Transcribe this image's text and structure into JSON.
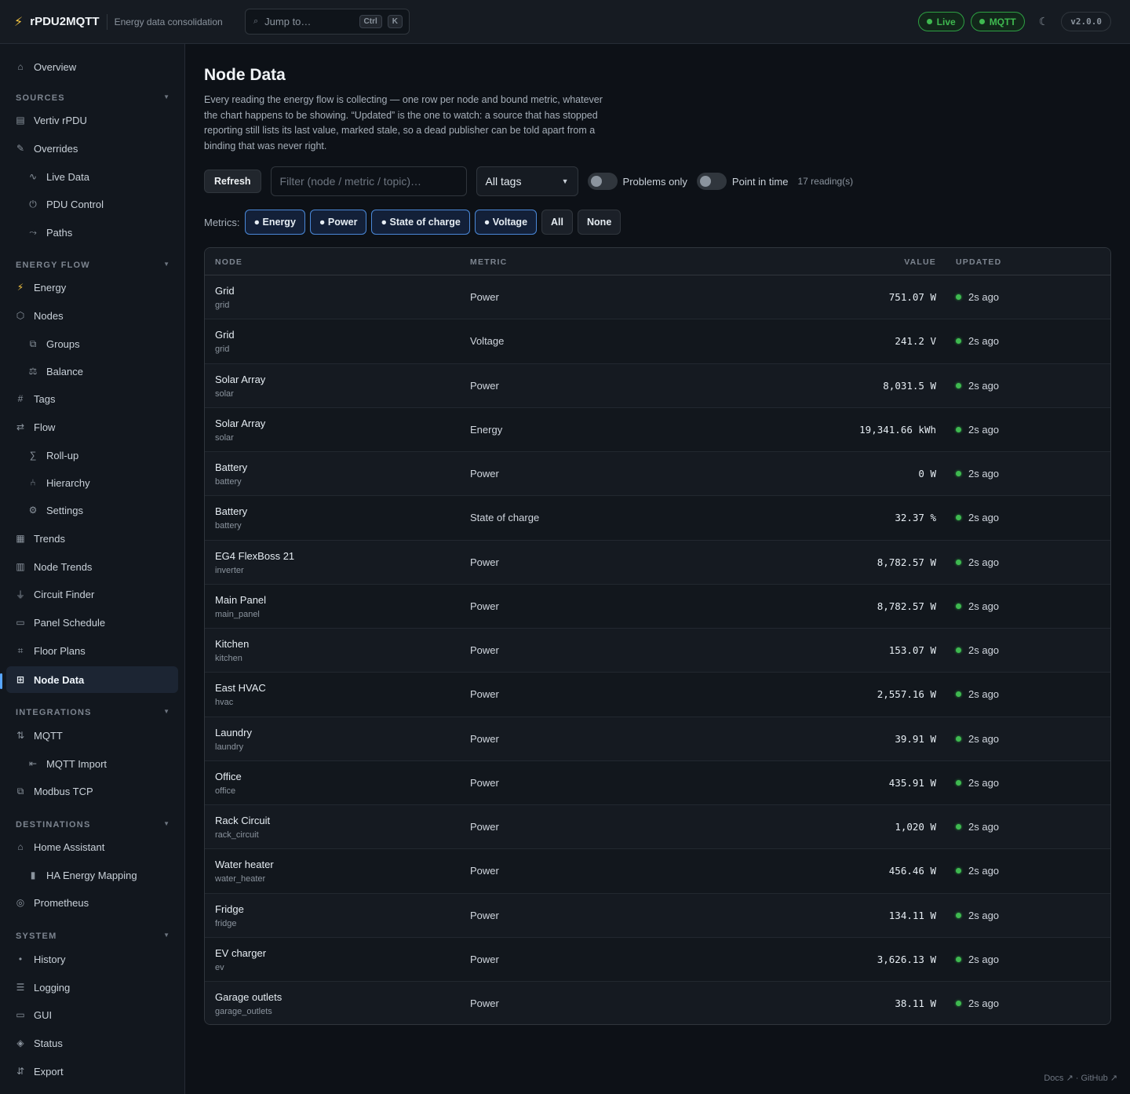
{
  "app": {
    "name": "rPDU2MQTT",
    "tagline": "Energy data consolidation",
    "jump_placeholder": "Jump to…",
    "kbd": [
      "Ctrl",
      "K"
    ],
    "badges": [
      "Live",
      "MQTT"
    ],
    "version": "v2.0.0"
  },
  "sidebar": {
    "overview": "Overview",
    "sections": {
      "sources": "SOURCES",
      "energy_flow": "ENERGY FLOW",
      "integrations": "INTEGRATIONS",
      "destinations": "DESTINATIONS",
      "system": "SYSTEM"
    },
    "items": {
      "vertiv": "Vertiv rPDU",
      "overrides": "Overrides",
      "live_data": "Live Data",
      "pdu_control": "PDU Control",
      "paths": "Paths",
      "energy": "Energy",
      "nodes": "Nodes",
      "groups": "Groups",
      "balance": "Balance",
      "tags": "Tags",
      "flow": "Flow",
      "rollup": "Roll-up",
      "hierarchy": "Hierarchy",
      "settings": "Settings",
      "trends": "Trends",
      "node_trends": "Node Trends",
      "circuit_finder": "Circuit Finder",
      "panel_schedule": "Panel Schedule",
      "floor_plans": "Floor Plans",
      "node_data": "Node Data",
      "mqtt": "MQTT",
      "mqtt_import": "MQTT Import",
      "modbus": "Modbus TCP",
      "home_assistant": "Home Assistant",
      "ha_energy": "HA Energy Mapping",
      "prometheus": "Prometheus",
      "history": "History",
      "logging": "Logging",
      "gui": "GUI",
      "status": "Status",
      "export": "Export"
    }
  },
  "page": {
    "title": "Node Data",
    "description": "Every reading the energy flow is collecting — one row per node and bound metric, whatever the chart happens to be showing. “Updated” is the one to watch: a source that has stopped reporting still lists its last value, marked stale, so a dead publisher can be told apart from a binding that was never right.",
    "refresh_label": "Refresh",
    "filter_placeholder": "Filter (node / metric / topic)…",
    "tags_select": "All tags",
    "problems_only": "Problems only",
    "point_in_time": "Point in time",
    "reading_count": "17 reading(s)",
    "metrics_label": "Metrics:",
    "metric_chips": [
      "● Energy",
      "● Power",
      "● State of charge",
      "● Voltage"
    ],
    "chip_all": "All",
    "chip_none": "None"
  },
  "table": {
    "headers": {
      "node": "NODE",
      "metric": "METRIC",
      "value": "VALUE",
      "updated": "UPDATED"
    },
    "rows": [
      {
        "node": "Grid",
        "id": "grid",
        "metric": "Power",
        "value": "751.07 W",
        "updated": "2s ago"
      },
      {
        "node": "Grid",
        "id": "grid",
        "metric": "Voltage",
        "value": "241.2 V",
        "updated": "2s ago"
      },
      {
        "node": "Solar Array",
        "id": "solar",
        "metric": "Power",
        "value": "8,031.5 W",
        "updated": "2s ago"
      },
      {
        "node": "Solar Array",
        "id": "solar",
        "metric": "Energy",
        "value": "19,341.66 kWh",
        "updated": "2s ago"
      },
      {
        "node": "Battery",
        "id": "battery",
        "metric": "Power",
        "value": "0 W",
        "updated": "2s ago"
      },
      {
        "node": "Battery",
        "id": "battery",
        "metric": "State of charge",
        "value": "32.37 %",
        "updated": "2s ago"
      },
      {
        "node": "EG4 FlexBoss 21",
        "id": "inverter",
        "metric": "Power",
        "value": "8,782.57 W",
        "updated": "2s ago"
      },
      {
        "node": "Main Panel",
        "id": "main_panel",
        "metric": "Power",
        "value": "8,782.57 W",
        "updated": "2s ago"
      },
      {
        "node": "Kitchen",
        "id": "kitchen",
        "metric": "Power",
        "value": "153.07 W",
        "updated": "2s ago"
      },
      {
        "node": "East HVAC",
        "id": "hvac",
        "metric": "Power",
        "value": "2,557.16 W",
        "updated": "2s ago"
      },
      {
        "node": "Laundry",
        "id": "laundry",
        "metric": "Power",
        "value": "39.91 W",
        "updated": "2s ago"
      },
      {
        "node": "Office",
        "id": "office",
        "metric": "Power",
        "value": "435.91 W",
        "updated": "2s ago"
      },
      {
        "node": "Rack Circuit",
        "id": "rack_circuit",
        "metric": "Power",
        "value": "1,020 W",
        "updated": "2s ago"
      },
      {
        "node": "Water heater",
        "id": "water_heater",
        "metric": "Power",
        "value": "456.46 W",
        "updated": "2s ago"
      },
      {
        "node": "Fridge",
        "id": "fridge",
        "metric": "Power",
        "value": "134.11 W",
        "updated": "2s ago"
      },
      {
        "node": "EV charger",
        "id": "ev",
        "metric": "Power",
        "value": "3,626.13 W",
        "updated": "2s ago"
      },
      {
        "node": "Garage outlets",
        "id": "garage_outlets",
        "metric": "Power",
        "value": "38.11 W",
        "updated": "2s ago"
      }
    ]
  },
  "footer": {
    "docs": "Docs ↗",
    "sep": "·",
    "github": "GitHub ↗"
  },
  "colors": {
    "accent": "#58a6ff",
    "live_green": "#3fb950",
    "brand_bolt": "#f5c542"
  }
}
